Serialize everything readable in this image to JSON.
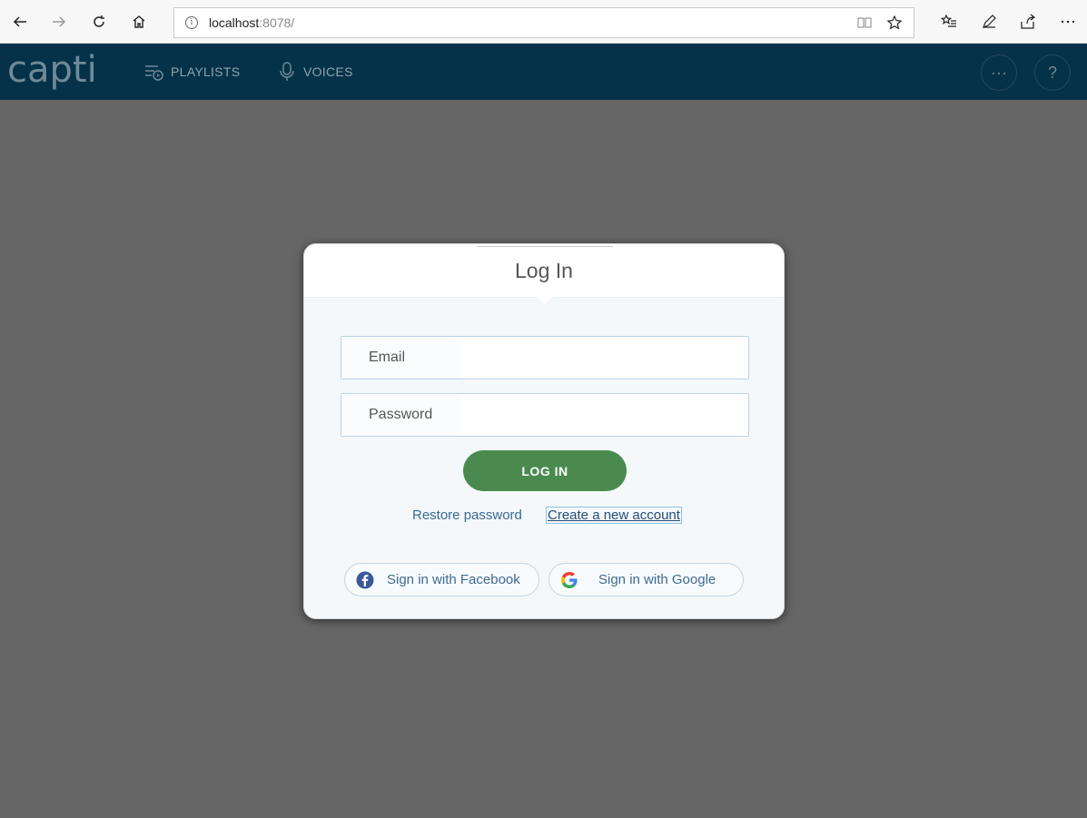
{
  "browser": {
    "url_host": "localhost",
    "url_port": ":8078/",
    "icons": [
      "back-icon",
      "forward-icon",
      "refresh-icon",
      "home-icon",
      "info-icon",
      "reading-view-icon",
      "favorite-star-icon",
      "favorites-list-icon",
      "pen-icon",
      "share-icon",
      "more-icon"
    ]
  },
  "app": {
    "logo_text": "capti",
    "nav": [
      {
        "label": "PLAYLISTS",
        "icon": "playlist-icon"
      },
      {
        "label": "VOICES",
        "icon": "microphone-icon"
      }
    ],
    "more_label": "···",
    "help_label": "?"
  },
  "dialog": {
    "title": "Log In",
    "email_placeholder": "Email",
    "password_placeholder": "Password",
    "login_label": "LOG IN",
    "restore_label": "Restore password",
    "create_label": "Create a new account",
    "facebook_label": "Sign in with Facebook",
    "google_label": "Sign in with Google"
  },
  "colors": {
    "header_bg": "#053249",
    "overlay_bg": "#666666",
    "login_button": "#4a8a4f",
    "link": "#3a6a90"
  }
}
